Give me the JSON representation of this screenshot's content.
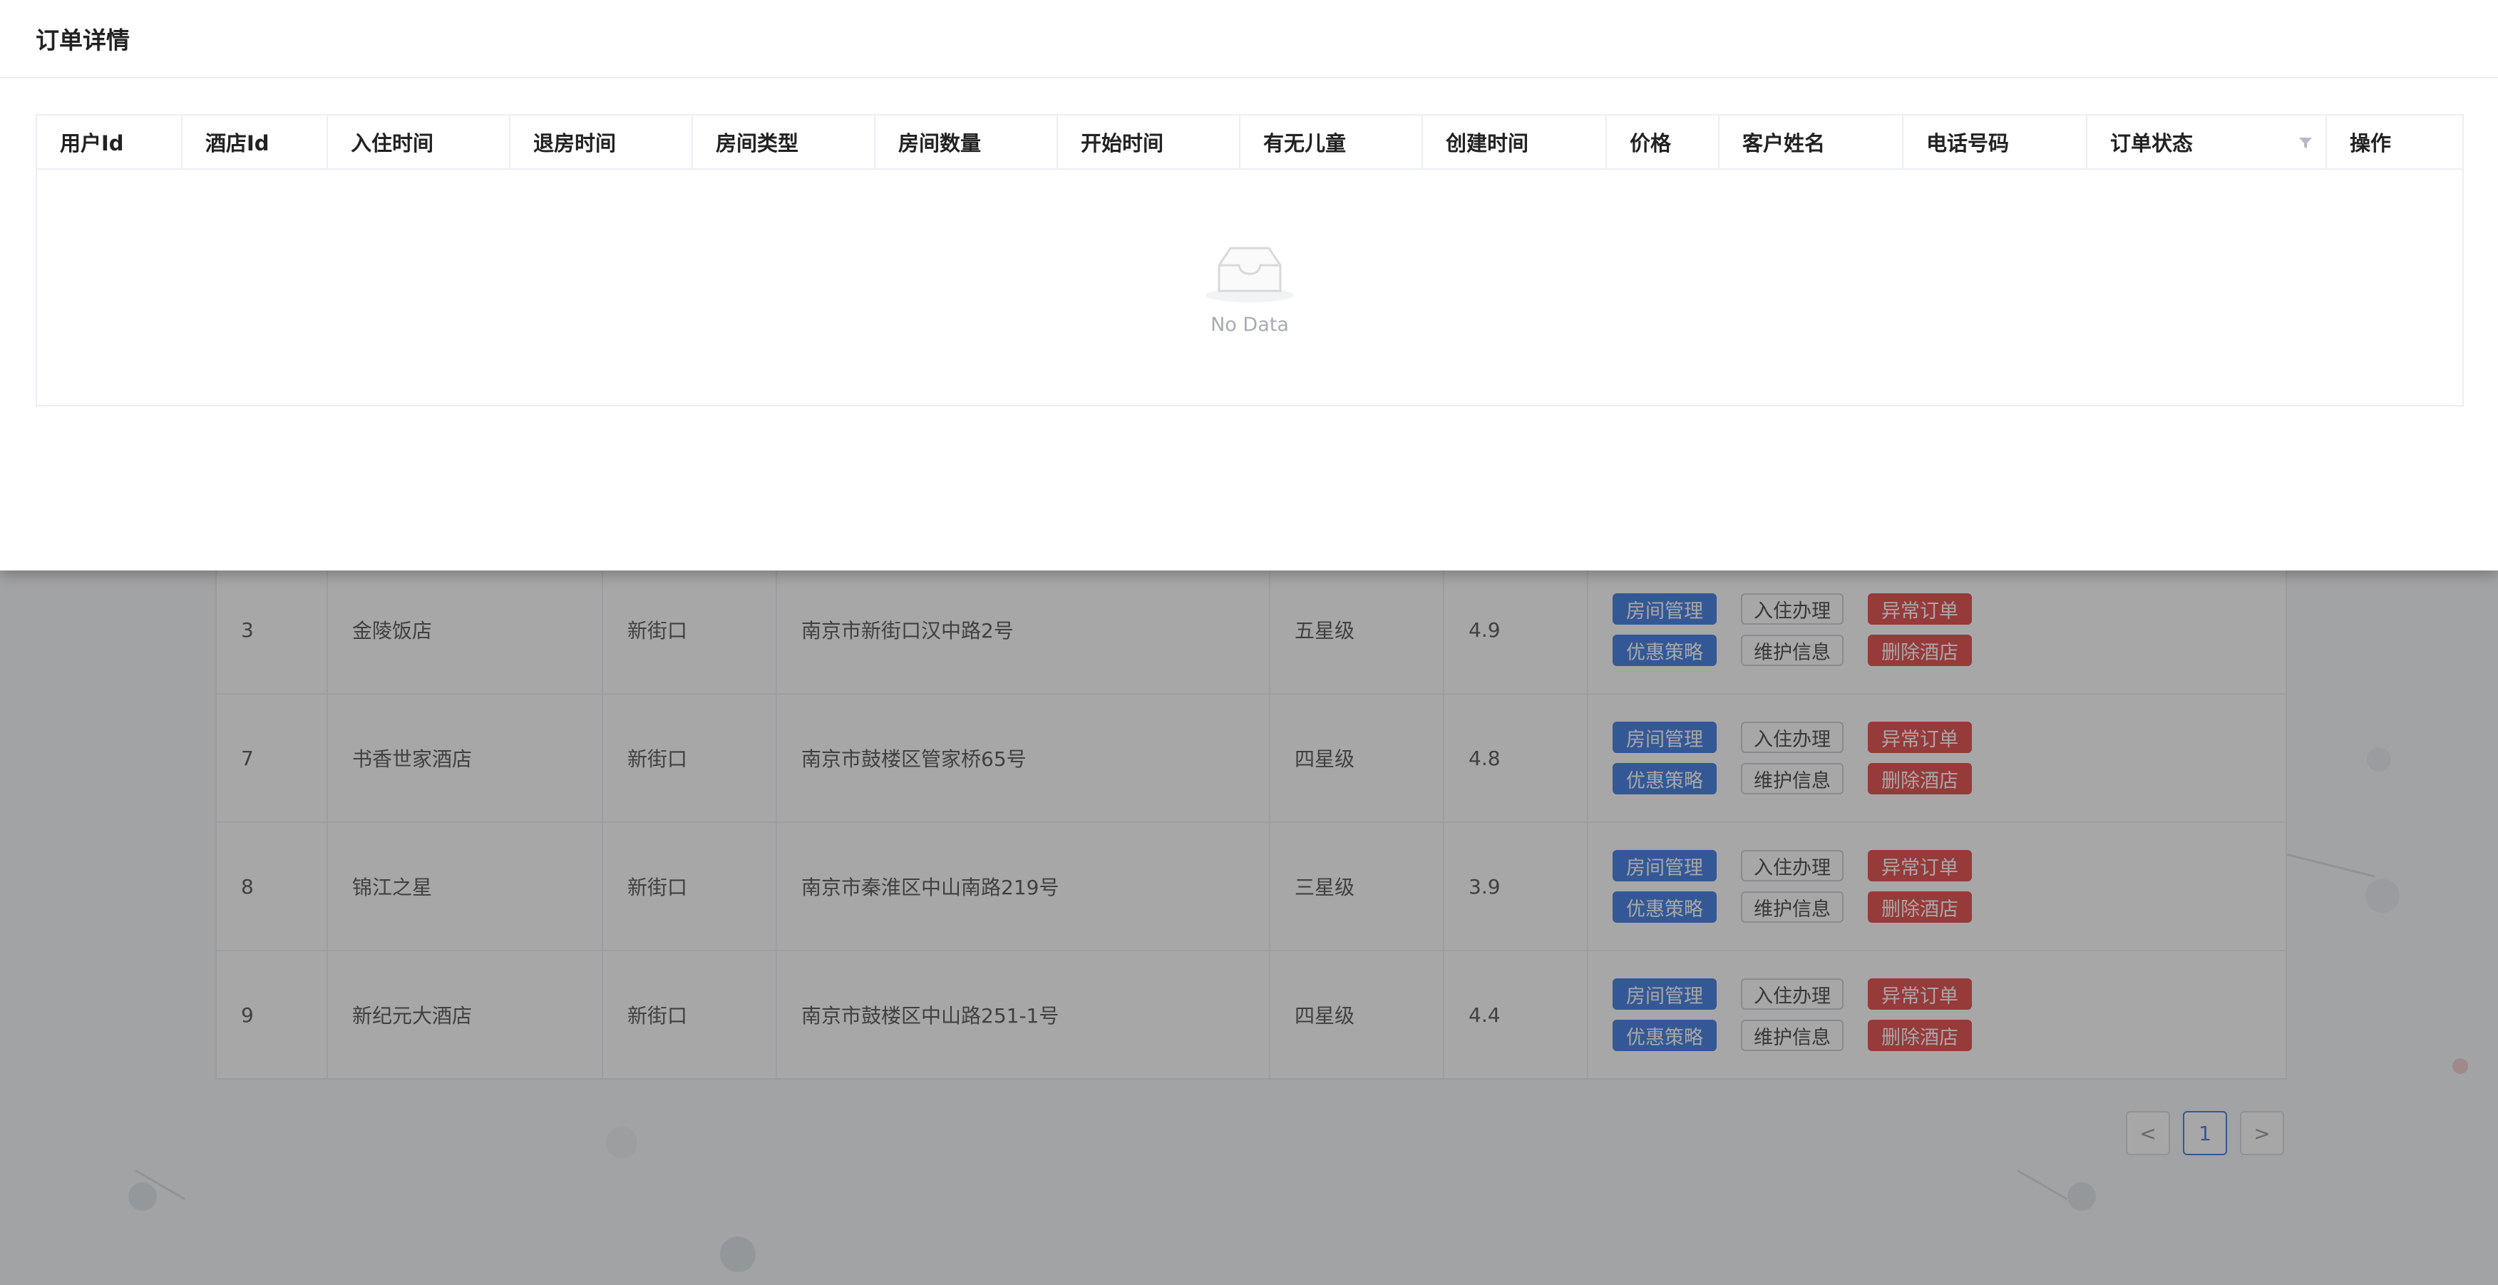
{
  "drawer": {
    "title": "订单详情",
    "columns": [
      "用户Id",
      "酒店Id",
      "入住时间",
      "退房时间",
      "房间类型",
      "房间数量",
      "开始时间",
      "有无儿童",
      "创建时间",
      "价格",
      "客户姓名",
      "电话号码",
      "订单状态",
      "操作"
    ],
    "empty_text": "No Data",
    "icons": {
      "empty": "inbox-empty-icon",
      "filter": "filter-icon"
    }
  },
  "hotels": {
    "rows": [
      {
        "id": "3",
        "name": "金陵饭店",
        "area": "新街口",
        "address": "南京市新街口汉中路2号",
        "star": "五星级",
        "score": "4.9"
      },
      {
        "id": "7",
        "name": "书香世家酒店",
        "area": "新街口",
        "address": "南京市鼓楼区管家桥65号",
        "star": "四星级",
        "score": "4.8"
      },
      {
        "id": "8",
        "name": "锦江之星",
        "area": "新街口",
        "address": "南京市秦淮区中山南路219号",
        "star": "三星级",
        "score": "3.9"
      },
      {
        "id": "9",
        "name": "新纪元大酒店",
        "area": "新街口",
        "address": "南京市鼓楼区中山路251-1号",
        "star": "四星级",
        "score": "4.4"
      }
    ],
    "actions": {
      "room_manage": "房间管理",
      "checkin": "入住办理",
      "abnormal_order": "异常订单",
      "discount": "优惠策略",
      "maintain": "维护信息",
      "delete_hotel": "删除酒店"
    }
  },
  "pagination": {
    "prev": "<",
    "current": "1",
    "next": ">"
  },
  "colors": {
    "primary": "#2f6fde",
    "danger": "#e23a3a"
  }
}
